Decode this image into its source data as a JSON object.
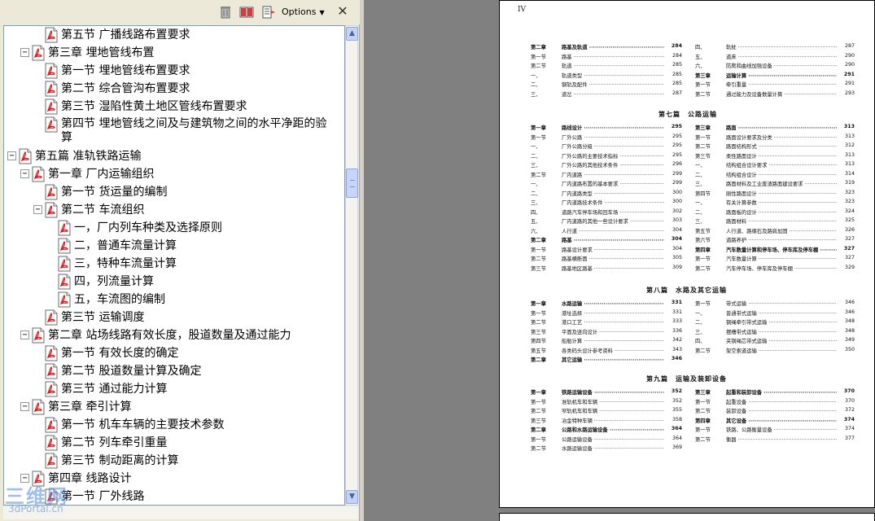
{
  "toolbar": {
    "options_label": "Options",
    "close_glyph": "✕"
  },
  "tree": [
    {
      "label": "第五节 广播线路布置要求",
      "level": 2,
      "toggle": "none"
    },
    {
      "label": "第三章 埋地管线布置",
      "level": 1,
      "toggle": "−"
    },
    {
      "label": "第一节 埋地管线布置要求",
      "level": 2,
      "toggle": "none"
    },
    {
      "label": "第二节 综合管沟布置要求",
      "level": 2,
      "toggle": "none"
    },
    {
      "label": "第三节 湿陷性黄土地区管线布置要求",
      "level": 2,
      "toggle": "none"
    },
    {
      "label": "第四节 埋地管线之间及与建筑物之间的水平净距的验算",
      "level": 2,
      "toggle": "none",
      "two_line": true
    },
    {
      "label": "第五篇 准轨铁路运输",
      "level": 0,
      "toggle": "−"
    },
    {
      "label": "第一章 厂内运输组织",
      "level": 1,
      "toggle": "−"
    },
    {
      "label": "第一节 货运量的编制",
      "level": 2,
      "toggle": "none"
    },
    {
      "label": "第二节 车流组织",
      "level": 2,
      "toggle": "−"
    },
    {
      "label": "一，厂内列车种类及选择原则",
      "level": 3,
      "toggle": "none"
    },
    {
      "label": "二，普通车流量计算",
      "level": 3,
      "toggle": "none"
    },
    {
      "label": "三，特种车流量计算",
      "level": 3,
      "toggle": "none"
    },
    {
      "label": "四，列流量计算",
      "level": 3,
      "toggle": "none"
    },
    {
      "label": "五，车流图的编制",
      "level": 3,
      "toggle": "none"
    },
    {
      "label": "第三节 运输调度",
      "level": 2,
      "toggle": "none"
    },
    {
      "label": "第二章 站场线路有效长度，股道数量及通过能力",
      "level": 1,
      "toggle": "−"
    },
    {
      "label": "第一节 有效长度的确定",
      "level": 2,
      "toggle": "none"
    },
    {
      "label": "第二节 股道数量计算及确定",
      "level": 2,
      "toggle": "none"
    },
    {
      "label": "第三节 通过能力计算",
      "level": 2,
      "toggle": "none"
    },
    {
      "label": "第三章 牵引计算",
      "level": 1,
      "toggle": "−"
    },
    {
      "label": "第一节 机车车辆的主要技术参数",
      "level": 2,
      "toggle": "none"
    },
    {
      "label": "第二节 列车牵引重量",
      "level": 2,
      "toggle": "none"
    },
    {
      "label": "第三节 制动距离的计算",
      "level": 2,
      "toggle": "none"
    },
    {
      "label": "第四章 线路设计",
      "level": 1,
      "toggle": "−"
    },
    {
      "label": "第一节 厂外线路",
      "level": 2,
      "toggle": "none"
    }
  ],
  "watermark": {
    "line1": "三维网",
    "line2": "3dPortal.cn"
  },
  "doc": {
    "page_mark": "IV",
    "top_left": [
      {
        "a": "第二章",
        "b": "路基及轨道",
        "p": "284",
        "bold": true
      },
      {
        "a": "第一节",
        "b": "路基",
        "p": "284"
      },
      {
        "a": "第二节",
        "b": "轨道",
        "p": "285"
      },
      {
        "a": "一、",
        "b": "轨道类型",
        "p": "285"
      },
      {
        "a": "二、",
        "b": "钢轨及配件",
        "p": "285"
      },
      {
        "a": "三、",
        "b": "道岔",
        "p": "287"
      }
    ],
    "top_right": [
      {
        "a": "四、",
        "b": "轨枕",
        "p": "287"
      },
      {
        "a": "五、",
        "b": "道床",
        "p": "290"
      },
      {
        "a": "六、",
        "b": "防爬和曲线加强设备",
        "p": "290"
      },
      {
        "a": "第三章",
        "b": "运输计算",
        "p": "291",
        "bold": true
      },
      {
        "a": "第一节",
        "b": "牵引重量",
        "p": "291"
      },
      {
        "a": "第二节",
        "b": "通过能力及设备数量计算",
        "p": "293"
      }
    ],
    "part7": "第七篇　公路运输",
    "p7_left": [
      {
        "a": "第一章",
        "b": "路线设计",
        "p": "295",
        "bold": true
      },
      {
        "a": "第一节",
        "b": "厂外公路",
        "p": "295"
      },
      {
        "a": "一、",
        "b": "厂外公路分级",
        "p": "295"
      },
      {
        "a": "二、",
        "b": "厂外公路的主要技术指标",
        "p": "295"
      },
      {
        "a": "三、",
        "b": "厂外公路的其他技术条件",
        "p": "296"
      },
      {
        "a": "第二节",
        "b": "厂内道路",
        "p": "299"
      },
      {
        "a": "一、",
        "b": "厂内道路布置的基本要求",
        "p": "299"
      },
      {
        "a": "二、",
        "b": "厂内道路类型",
        "p": "300"
      },
      {
        "a": "三、",
        "b": "厂内道路技术条件",
        "p": "300"
      },
      {
        "a": "四、",
        "b": "道路汽车停车场和回车场",
        "p": "302"
      },
      {
        "a": "五、",
        "b": "厂内道路的其他一些设计要求",
        "p": "303"
      },
      {
        "a": "六、",
        "b": "人行道",
        "p": "304"
      },
      {
        "a": "第二章",
        "b": "路基",
        "p": "304",
        "bold": true
      },
      {
        "a": "第一节",
        "b": "路基设计要求",
        "p": "304"
      },
      {
        "a": "第二节",
        "b": "路基横断面",
        "p": "305"
      },
      {
        "a": "第三节",
        "b": "路基地区路基",
        "p": "309"
      }
    ],
    "p7_right": [
      {
        "a": "第三章",
        "b": "路面",
        "p": "313",
        "bold": true
      },
      {
        "a": "第一节",
        "b": "路面设计要求及分类",
        "p": "313"
      },
      {
        "a": "第二节",
        "b": "路面结构形式",
        "p": "312"
      },
      {
        "a": "第三节",
        "b": "柔性路面设计",
        "p": "313"
      },
      {
        "a": "一、",
        "b": "结构组合设计要求",
        "p": "313"
      },
      {
        "a": "二、",
        "b": "结构组合设计",
        "p": "314"
      },
      {
        "a": "三、",
        "b": "路面材料及工业废渣路面建设要求",
        "p": "319"
      },
      {
        "a": "第四节",
        "b": "刚性路面设计",
        "p": "323"
      },
      {
        "a": "一、",
        "b": "有关计算参数",
        "p": "323"
      },
      {
        "a": "二、",
        "b": "路面板的设计",
        "p": "324"
      },
      {
        "a": "三、",
        "b": "路面材料",
        "p": "325"
      },
      {
        "a": "第五节",
        "b": "人行道、路缘石及路肩加固",
        "p": "326"
      },
      {
        "a": "第六节",
        "b": "道路养护",
        "p": "327"
      },
      {
        "a": "第四章",
        "b": "汽车数量计算和停车场、停车库及停车棚",
        "p": "327",
        "bold": true
      },
      {
        "a": "第一节",
        "b": "汽车数量计算",
        "p": "327"
      },
      {
        "a": "第二节",
        "b": "汽车停车场、停车库及停车棚",
        "p": "329"
      }
    ],
    "part8": "第八篇　水路及其它运输",
    "p8_left": [
      {
        "a": "第一章",
        "b": "水路运输",
        "p": "331",
        "bold": true
      },
      {
        "a": "第一节",
        "b": "港址选择",
        "p": "331"
      },
      {
        "a": "第二节",
        "b": "港口工艺",
        "p": "333"
      },
      {
        "a": "第三节",
        "b": "平面及竖向设计",
        "p": "336"
      },
      {
        "a": "第四节",
        "b": "船舶计算",
        "p": "342"
      },
      {
        "a": "第五节",
        "b": "各类码头设计参考资料",
        "p": "343"
      },
      {
        "a": "第二章",
        "b": "其它运输",
        "p": "346",
        "bold": true
      }
    ],
    "p8_right": [
      {
        "a": "第一节",
        "b": "带式运输",
        "p": "346"
      },
      {
        "a": "一、",
        "b": "普通带式运输",
        "p": "346"
      },
      {
        "a": "二、",
        "b": "钢绳牵引带式运输",
        "p": "348"
      },
      {
        "a": "三、",
        "b": "摆槽带式运输",
        "p": "348"
      },
      {
        "a": "四、",
        "b": "夹钢绳芯带式运输",
        "p": "349"
      },
      {
        "a": "第二节",
        "b": "架空索道运输",
        "p": "350"
      }
    ],
    "part9": "第九篇　运输及装卸设备",
    "p9_left": [
      {
        "a": "第一章",
        "b": "铁路运输设备",
        "p": "352",
        "bold": true
      },
      {
        "a": "第一节",
        "b": "准轨机车和车辆",
        "p": "352"
      },
      {
        "a": "第二节",
        "b": "窄轨机车和车辆",
        "p": "355"
      },
      {
        "a": "第三节",
        "b": "冶金特种车辆",
        "p": "358"
      },
      {
        "a": "第二章",
        "b": "公路和水路运输设备",
        "p": "364",
        "bold": true
      },
      {
        "a": "第一节",
        "b": "公路运输设备",
        "p": "364"
      },
      {
        "a": "第二节",
        "b": "水路运输设备",
        "p": "369"
      }
    ],
    "p9_right": [
      {
        "a": "第三章",
        "b": "起重和装卸设备",
        "p": "370",
        "bold": true
      },
      {
        "a": "第一节",
        "b": "起重设备",
        "p": "370"
      },
      {
        "a": "第二节",
        "b": "装卸设备",
        "p": "372"
      },
      {
        "a": "第四章",
        "b": "其它设备",
        "p": "374",
        "bold": true
      },
      {
        "a": "第一节",
        "b": "铁路、公路衡量设备",
        "p": "374"
      },
      {
        "a": "第二节",
        "b": "衡器",
        "p": "377"
      }
    ]
  }
}
